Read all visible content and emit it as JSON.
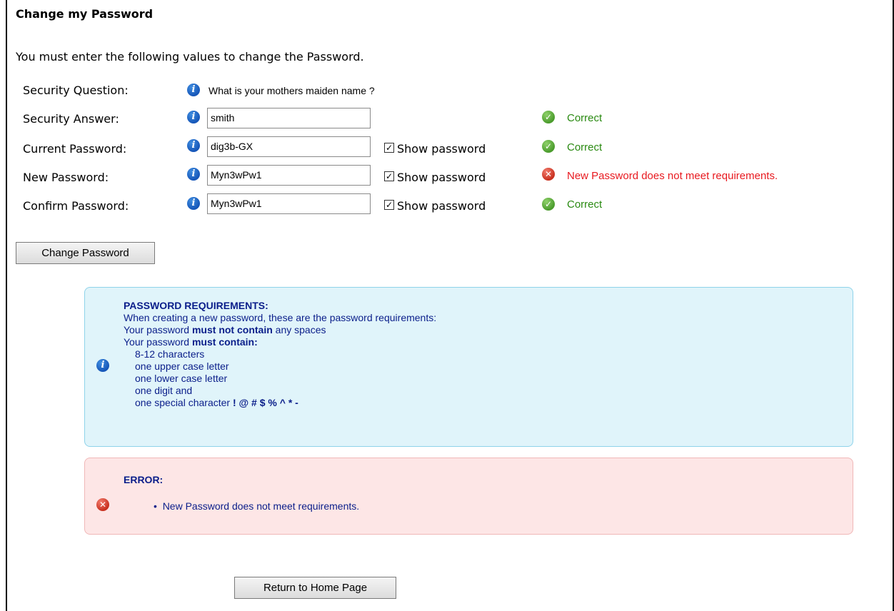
{
  "page": {
    "title": "Change my Password",
    "intro": "You must enter the following values to change the Password."
  },
  "form": {
    "security_question": {
      "label": "Security Question:",
      "value": "What is your mothers maiden name ?"
    },
    "security_answer": {
      "label": "Security Answer:",
      "value": "smith",
      "status": "Correct"
    },
    "current_password": {
      "label": "Current Password:",
      "value": "dig3b-GX",
      "show_label": "Show password",
      "status": "Correct"
    },
    "new_password": {
      "label": "New Password:",
      "value": "Myn3wPw1",
      "show_label": "Show password",
      "status": "New Password does not meet requirements."
    },
    "confirm_password": {
      "label": "Confirm Password:",
      "value": "Myn3wPw1",
      "show_label": "Show password",
      "status": "Correct"
    },
    "submit_label": "Change Password"
  },
  "requirements": {
    "heading": "PASSWORD REQUIREMENTS:",
    "line1": "When creating a new password, these are the password requirements:",
    "line2_pre": "Your password ",
    "line2_bold": "must not contain",
    "line2_post": " any spaces",
    "line3_pre": "Your password ",
    "line3_bold": "must contain:",
    "items": [
      "8-12 characters",
      "one upper case letter",
      "one lower case letter",
      "one digit and"
    ],
    "special_pre": "one special character ",
    "special_chars": "! @ # $ % ^ * -"
  },
  "error_box": {
    "heading": "ERROR:",
    "message": "New Password does not meet requirements."
  },
  "return_label": "Return to Home Page",
  "colors": {
    "correct": "#2a8a12",
    "error": "#e8191f",
    "info_box_bg": "#e0f4fa",
    "error_box_bg": "#fde6e6",
    "requirements_text": "#0a1e8a"
  },
  "icons": {
    "info": "info-icon",
    "ok": "check-circle-icon",
    "error": "x-circle-icon"
  }
}
